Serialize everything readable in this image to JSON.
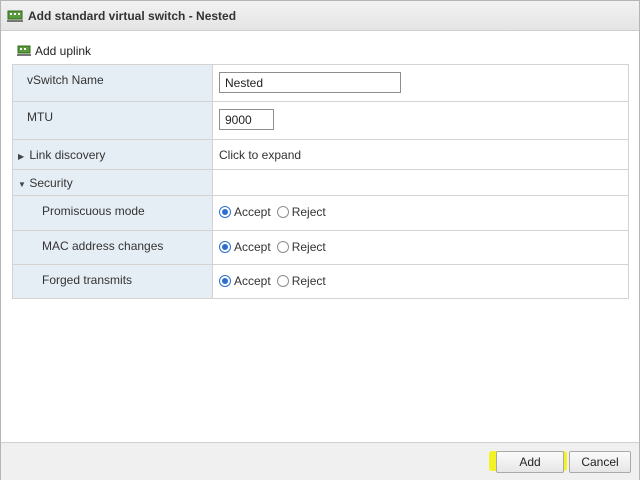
{
  "dialog": {
    "title": "Add standard virtual switch - Nested"
  },
  "toolbar": {
    "add_uplink_label": "Add uplink"
  },
  "form": {
    "vswitch_name": {
      "label": "vSwitch Name",
      "value": "Nested"
    },
    "mtu": {
      "label": "MTU",
      "value": "9000"
    },
    "link_discovery": {
      "label": "Link discovery",
      "value": "Click to expand"
    },
    "security": {
      "label": "Security"
    },
    "promiscuous_mode": {
      "label": "Promiscuous mode",
      "accept": "Accept",
      "reject": "Reject",
      "selected": "Accept"
    },
    "mac_address_changes": {
      "label": "MAC address changes",
      "accept": "Accept",
      "reject": "Reject",
      "selected": "Accept"
    },
    "forged_transmits": {
      "label": "Forged transmits",
      "accept": "Accept",
      "reject": "Reject",
      "selected": "Accept"
    }
  },
  "footer": {
    "add_label": "Add",
    "cancel_label": "Cancel"
  },
  "colors": {
    "label_bg": "#e6eef5",
    "radio_accent": "#2b6ed0",
    "highlight": "#f2f200"
  }
}
